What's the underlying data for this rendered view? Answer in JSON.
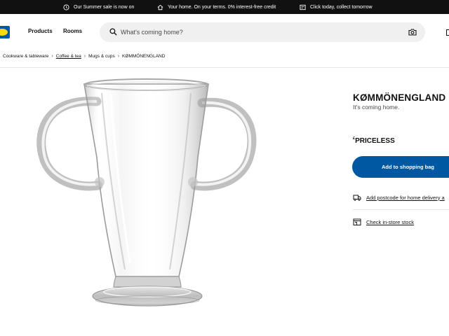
{
  "promo_bar": {
    "items": [
      {
        "icon": "clock-icon",
        "text": "Our Summer sale is now on"
      },
      {
        "icon": "home-icon",
        "text": "Your home. On your terms. 0% interest-free credit"
      },
      {
        "icon": "receipt-icon",
        "text": "Click today, collect tomorrow"
      }
    ]
  },
  "header": {
    "nav": [
      "Products",
      "Rooms"
    ],
    "search_placeholder": "What's coming home?"
  },
  "breadcrumb": [
    "Cookware & tableware",
    "Coffee & tea",
    "Mugs & cups",
    "KØMMÖNENGLAND"
  ],
  "product": {
    "title": "KØMMÖNENGLAND",
    "subtitle": "It's coming home.",
    "price_symbol": "£",
    "price": "PRICELESS",
    "add_button": "Add to shopping bag",
    "delivery_link": "Add postcode for home delivery a",
    "stock_link": "Check in-store stock"
  },
  "colors": {
    "accent": "#0058a3",
    "promo_bar": "#111111",
    "logo_yellow": "#fbd914"
  }
}
